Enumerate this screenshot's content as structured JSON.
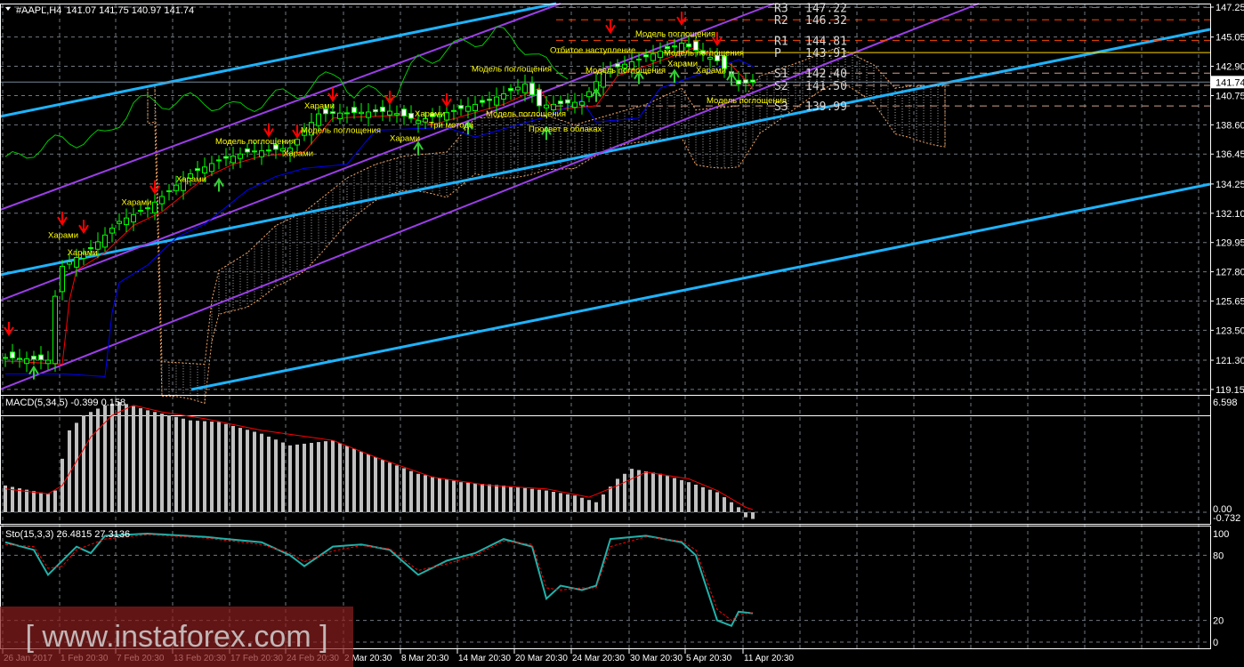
{
  "header": {
    "symbol": "#AAPL,H4",
    "ohlc": "141.07 141.75 140.97 141.74"
  },
  "price_axis": {
    "ticks": [
      "147.25",
      "145.05",
      "142.90",
      "140.75",
      "138.60",
      "136.45",
      "134.25",
      "132.10",
      "129.95",
      "127.80",
      "125.65",
      "123.50",
      "121.30",
      "119.15"
    ],
    "current": "141.74"
  },
  "time_axis": {
    "labels": [
      "26 Jan 2017",
      "1 Feb 20:30",
      "7 Feb 20:30",
      "13 Feb 20:30",
      "17 Feb 20:30",
      "24 Feb 20:30",
      "2 Mar 20:30",
      "8 Mar 20:30",
      "14 Mar 20:30",
      "20 Mar 20:30",
      "24 Mar 20:30",
      "30 Mar 20:30",
      "5 Apr 20:30",
      "11 Apr 20:30"
    ]
  },
  "pivots": [
    {
      "label": "R3",
      "value": "147.22",
      "color": "#ff4500"
    },
    {
      "label": "R2",
      "value": "146.32",
      "color": "#ff4500"
    },
    {
      "label": "R1",
      "value": "144.81",
      "color": "#ff4500"
    },
    {
      "label": "P",
      "value": "143.91",
      "color": "#ffd700"
    },
    {
      "label": "S1",
      "value": "142.40",
      "color": "#d2a08c"
    },
    {
      "label": "S2",
      "value": "141.50",
      "color": "#d2a08c"
    },
    {
      "label": "S3",
      "value": "139.99",
      "color": "#d2a08c"
    }
  ],
  "macd": {
    "label": "MACD(5,34,5) -0.399 0.158",
    "ticks": [
      "6.598",
      "0.00",
      "-0.732"
    ]
  },
  "stoch": {
    "label": "Sto(15,3,3) 26.4815 27.3136",
    "ticks": [
      "100",
      "80",
      "20",
      "0"
    ]
  },
  "watermark": "[ www.instaforex.com ]",
  "annotations": [
    {
      "text": "Харами",
      "bar": 8.5,
      "price": 130.3
    },
    {
      "text": "Харами",
      "bar": 11.2,
      "price": 129.0
    },
    {
      "text": "Харами",
      "bar": 18.8,
      "price": 132.7
    },
    {
      "text": "Харами",
      "bar": 26.5,
      "price": 134.4
    },
    {
      "text": "Модель поглощения",
      "bar": 32,
      "price": 137.2
    },
    {
      "text": "Харами",
      "bar": 41.5,
      "price": 136.3
    },
    {
      "text": "Модель поглощения",
      "bar": 44,
      "price": 138.0
    },
    {
      "text": "Харами",
      "bar": 44.5,
      "price": 139.8
    },
    {
      "text": "Харами",
      "bar": 56.5,
      "price": 137.4
    },
    {
      "text": "Харами",
      "bar": 60,
      "price": 139.2
    },
    {
      "text": "Три метода",
      "bar": 62,
      "price": 138.4
    },
    {
      "text": "Модель поглощения",
      "bar": 68,
      "price": 142.5
    },
    {
      "text": "Модель поглощения",
      "bar": 70,
      "price": 139.2
    },
    {
      "text": "Просвет в облаках",
      "bar": 76,
      "price": 138.1
    },
    {
      "text": "Отбитое наступление",
      "bar": 79,
      "price": 143.9
    },
    {
      "text": "Модель поглощения",
      "bar": 84,
      "price": 142.4
    },
    {
      "text": "Модель поглощения",
      "bar": 91,
      "price": 145.1
    },
    {
      "text": "Харами",
      "bar": 95.5,
      "price": 142.9
    },
    {
      "text": "Модель поглощения",
      "bar": 95,
      "price": 143.7
    },
    {
      "text": "Харами",
      "bar": 99.5,
      "price": 142.4
    },
    {
      "text": "Модель поглощения",
      "bar": 101,
      "price": 140.2
    }
  ],
  "chart_data": {
    "type": "line",
    "title": "#AAPL,H4",
    "ylim": [
      119.15,
      147.25
    ],
    "close_keypoints": [
      [
        0,
        121.5
      ],
      [
        6,
        121.3
      ],
      [
        7,
        126
      ],
      [
        8,
        128.2
      ],
      [
        12,
        129.5
      ],
      [
        16,
        131.5
      ],
      [
        20,
        132.5
      ],
      [
        26,
        135
      ],
      [
        30,
        136
      ],
      [
        34,
        136.6
      ],
      [
        40,
        136.9
      ],
      [
        44,
        139.4
      ],
      [
        54,
        139.6
      ],
      [
        58,
        138.9
      ],
      [
        62,
        139.5
      ],
      [
        68,
        140.4
      ],
      [
        73,
        141.6
      ],
      [
        75,
        140.0
      ],
      [
        81,
        140.3
      ],
      [
        84,
        142.5
      ],
      [
        90,
        143.6
      ],
      [
        95,
        144.6
      ],
      [
        100,
        143.3
      ],
      [
        103,
        141.6
      ],
      [
        105,
        141.74
      ]
    ],
    "macd_hist_keypoints": [
      [
        0,
        1.6
      ],
      [
        6,
        1.1
      ],
      [
        7,
        1.3
      ],
      [
        8,
        3.2
      ],
      [
        9,
        4.9
      ],
      [
        11,
        5.8
      ],
      [
        14,
        6.4
      ],
      [
        16,
        6.6
      ],
      [
        20,
        6.1
      ],
      [
        26,
        5.5
      ],
      [
        30,
        5.4
      ],
      [
        36,
        4.7
      ],
      [
        40,
        4.0
      ],
      [
        46,
        4.3
      ],
      [
        52,
        3.3
      ],
      [
        58,
        2.3
      ],
      [
        64,
        1.8
      ],
      [
        70,
        1.6
      ],
      [
        76,
        1.3
      ],
      [
        80,
        1.0
      ],
      [
        83,
        0.6
      ],
      [
        86,
        2.0
      ],
      [
        88,
        2.6
      ],
      [
        92,
        2.3
      ],
      [
        96,
        1.8
      ],
      [
        100,
        1.2
      ],
      [
        103,
        0.3
      ],
      [
        104,
        -0.3
      ],
      [
        105,
        -0.4
      ]
    ],
    "macd_signal_keypoints": [
      [
        0,
        1.4
      ],
      [
        6,
        1.1
      ],
      [
        8,
        1.6
      ],
      [
        12,
        4.5
      ],
      [
        15,
        5.8
      ],
      [
        18,
        6.4
      ],
      [
        22,
        6.0
      ],
      [
        28,
        5.6
      ],
      [
        36,
        4.9
      ],
      [
        46,
        4.3
      ],
      [
        52,
        3.3
      ],
      [
        60,
        2.1
      ],
      [
        68,
        1.6
      ],
      [
        76,
        1.4
      ],
      [
        82,
        0.9
      ],
      [
        86,
        1.6
      ],
      [
        90,
        2.4
      ],
      [
        96,
        2.0
      ],
      [
        100,
        1.3
      ],
      [
        104,
        0.3
      ],
      [
        105,
        0.16
      ]
    ],
    "stoch_main_keypoints": [
      [
        0,
        92
      ],
      [
        4,
        85
      ],
      [
        6,
        62
      ],
      [
        8,
        75
      ],
      [
        10,
        88
      ],
      [
        12,
        82
      ],
      [
        14,
        98
      ],
      [
        20,
        100
      ],
      [
        28,
        97
      ],
      [
        36,
        92
      ],
      [
        40,
        80
      ],
      [
        42,
        70
      ],
      [
        46,
        88
      ],
      [
        50,
        90
      ],
      [
        54,
        85
      ],
      [
        58,
        62
      ],
      [
        62,
        75
      ],
      [
        66,
        82
      ],
      [
        70,
        95
      ],
      [
        74,
        88
      ],
      [
        76,
        40
      ],
      [
        78,
        52
      ],
      [
        81,
        48
      ],
      [
        83,
        52
      ],
      [
        85,
        95
      ],
      [
        90,
        98
      ],
      [
        95,
        92
      ],
      [
        97,
        80
      ],
      [
        100,
        20
      ],
      [
        102,
        15
      ],
      [
        103,
        28
      ],
      [
        105,
        26.5
      ]
    ],
    "stoch_signal_keypoints": [
      [
        0,
        90
      ],
      [
        4,
        88
      ],
      [
        6,
        68
      ],
      [
        8,
        70
      ],
      [
        10,
        85
      ],
      [
        14,
        95
      ],
      [
        20,
        99
      ],
      [
        28,
        96
      ],
      [
        36,
        90
      ],
      [
        40,
        82
      ],
      [
        42,
        74
      ],
      [
        46,
        84
      ],
      [
        50,
        89
      ],
      [
        54,
        86
      ],
      [
        58,
        66
      ],
      [
        62,
        72
      ],
      [
        66,
        80
      ],
      [
        70,
        93
      ],
      [
        74,
        90
      ],
      [
        76,
        50
      ],
      [
        78,
        48
      ],
      [
        81,
        50
      ],
      [
        83,
        50
      ],
      [
        85,
        88
      ],
      [
        90,
        97
      ],
      [
        95,
        93
      ],
      [
        97,
        85
      ],
      [
        100,
        30
      ],
      [
        102,
        20
      ],
      [
        103,
        25
      ],
      [
        105,
        27.3
      ]
    ],
    "signals": [
      {
        "bar": 0.5,
        "price": 123.2,
        "dir": "down"
      },
      {
        "bar": 8,
        "price": 131.3,
        "dir": "down"
      },
      {
        "bar": 11,
        "price": 130.7,
        "dir": "down"
      },
      {
        "bar": 21,
        "price": 133.6,
        "dir": "down"
      },
      {
        "bar": 37,
        "price": 137.8,
        "dir": "down"
      },
      {
        "bar": 41,
        "price": 137.7,
        "dir": "down"
      },
      {
        "bar": 46,
        "price": 140.4,
        "dir": "down"
      },
      {
        "bar": 54,
        "price": 140.2,
        "dir": "down"
      },
      {
        "bar": 62,
        "price": 140.0,
        "dir": "down"
      },
      {
        "bar": 85,
        "price": 145.4,
        "dir": "down"
      },
      {
        "bar": 95,
        "price": 146.0,
        "dir": "down"
      },
      {
        "bar": 100,
        "price": 144.5,
        "dir": "down"
      },
      {
        "bar": 4,
        "price": 120.8,
        "dir": "up"
      },
      {
        "bar": 30,
        "price": 134.6,
        "dir": "up"
      },
      {
        "bar": 58,
        "price": 137.3,
        "dir": "up"
      },
      {
        "bar": 65,
        "price": 138.8,
        "dir": "up"
      },
      {
        "bar": 76,
        "price": 138.4,
        "dir": "up"
      },
      {
        "bar": 83,
        "price": 141.2,
        "dir": "up"
      },
      {
        "bar": 89,
        "price": 142.5,
        "dir": "up"
      },
      {
        "bar": 94,
        "price": 142.6,
        "dir": "up"
      },
      {
        "bar": 102,
        "price": 142.4,
        "dir": "up"
      }
    ]
  }
}
